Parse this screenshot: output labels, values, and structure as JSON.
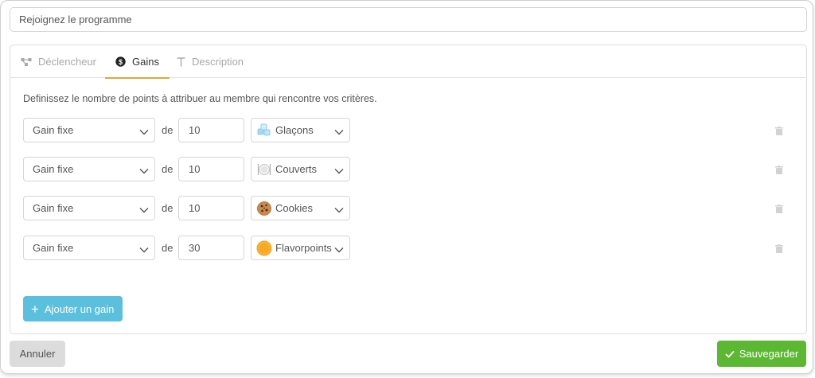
{
  "program_name": {
    "value": "Rejoignez le programme"
  },
  "tabs": [
    {
      "label": "Déclencheur",
      "icon": "trigger-nodes-icon"
    },
    {
      "label": "Gains",
      "icon": "dollar-coin-icon",
      "active": true
    },
    {
      "label": "Description",
      "icon": "text-t-icon"
    }
  ],
  "intro": "Definissez le nombre de points à attribuer au membre qui rencontre vos critères.",
  "gains": [
    {
      "type": "Gain fixe",
      "connector": "de",
      "amount": "10",
      "currency": "Glaçons",
      "icon": "ice-cubes-icon"
    },
    {
      "type": "Gain fixe",
      "connector": "de",
      "amount": "10",
      "currency": "Couverts",
      "icon": "plate-cutlery-icon"
    },
    {
      "type": "Gain fixe",
      "connector": "de",
      "amount": "10",
      "currency": "Cookies",
      "icon": "cookie-icon"
    },
    {
      "type": "Gain fixe",
      "connector": "de",
      "amount": "30",
      "currency": "Flavorpoints",
      "icon": "orange-coin-icon"
    }
  ],
  "add_button": {
    "label": "Ajouter un gain"
  },
  "cancel_button": {
    "label": "Annuler"
  },
  "save_button": {
    "label": "Sauvegarder"
  },
  "colors": {
    "tab_underline": "#e0a83a",
    "add_button": "#5bc0de",
    "save_button": "#5cb833",
    "cancel_button": "#dcdcdc"
  }
}
